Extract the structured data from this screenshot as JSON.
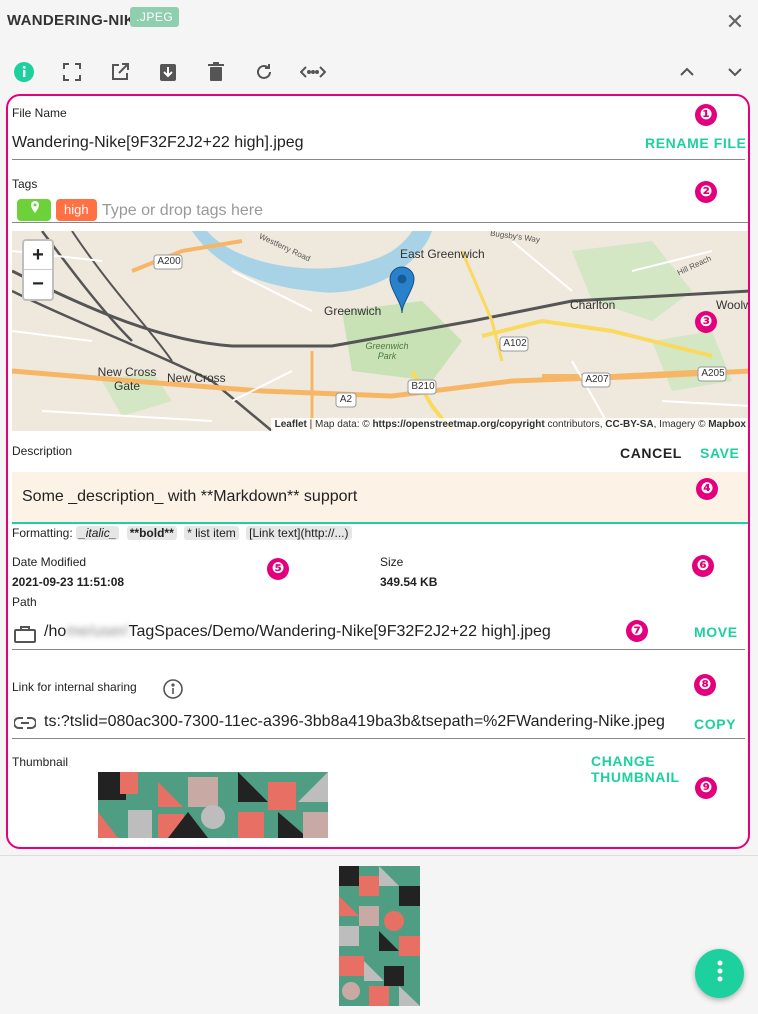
{
  "header": {
    "title": "WANDERING-NIKE",
    "ext_badge": ".JPEG"
  },
  "toolbar": {
    "left_icons": [
      "info-icon",
      "fullscreen-icon",
      "open-external-icon",
      "download-icon",
      "delete-icon",
      "reload-icon",
      "navigate-icon"
    ],
    "right_icons": [
      "chevron-up-icon",
      "chevron-down-icon"
    ]
  },
  "file_name": {
    "label": "File Name",
    "value": "Wandering-Nike[9F32F2J2+22 high].jpeg",
    "action": "RENAME FILE"
  },
  "tags": {
    "label": "Tags",
    "items": [
      "high"
    ],
    "placeholder": "Type or drop tags here"
  },
  "map": {
    "places": [
      "East Greenwich",
      "Greenwich",
      "Charlton",
      "New Cross Gate",
      "New Cross",
      "Greenwich Park",
      "Woolw",
      "Westferry Road",
      "Bugsby's Way",
      "Hill Reach"
    ],
    "roads": [
      "A200",
      "A102",
      "B210",
      "A207",
      "A205",
      "A2"
    ],
    "zoom_in": "+",
    "zoom_out": "−",
    "attribution_leaflet": "Leaflet",
    "attribution_text": "| Map data: ©",
    "attribution_osm": "https://openstreetmap.org/copyright",
    "attribution_contrib": "contributors,",
    "attribution_ccbysa": "CC-BY-SA",
    "attribution_imagery": ", Imagery ©",
    "attribution_mapbox": "Mapbox"
  },
  "description": {
    "label": "Description",
    "cancel": "CANCEL",
    "save": "SAVE",
    "value": "Some _description_ with **Markdown** support"
  },
  "formatting": {
    "label": "Formatting:",
    "chips": [
      "_italic_",
      "**bold**",
      "* list item",
      "[Link text](http://...)"
    ]
  },
  "meta": {
    "date_label": "Date Modified",
    "date_value": "2021-09-23 11:51:08",
    "size_label": "Size",
    "size_value": "349.54 KB"
  },
  "path": {
    "label": "Path",
    "prefix": "/ho",
    "blurred": "me/user/",
    "suffix": "TagSpaces/Demo/Wandering-Nike[9F32F2J2+22 high].jpeg",
    "action": "MOVE"
  },
  "sharing": {
    "label": "Link for internal sharing",
    "value": "ts:?tslid=080ac300-7300-11ec-a396-3bb8a419ba3b&tsepath=%2FWandering-Nike.jpeg",
    "action": "COPY"
  },
  "thumbnail": {
    "label": "Thumbnail",
    "action": "CHANGE THUMBNAIL"
  },
  "markers": [
    "❶",
    "❷",
    "❸",
    "❹",
    "❺",
    "❻",
    "❼",
    "❽",
    "❾"
  ],
  "colors": {
    "accent": "#1dd19f",
    "marker": "#e4007c",
    "tag_geo": "#6dd13a",
    "tag_high": "#ff7043"
  }
}
